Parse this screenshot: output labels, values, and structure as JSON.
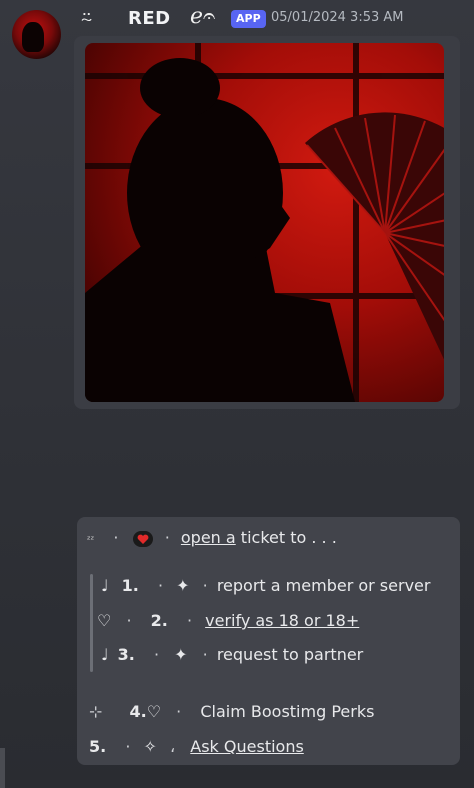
{
  "header": {
    "deco_left": "⍨",
    "bot_name": "RED",
    "deco_right": "ℯ𝄐",
    "badge": "APP",
    "timestamp": "05/01/2024 3:53 AM"
  },
  "embed_menu": {
    "title_prefix": "ᶻᶻ",
    "title_dot1": "·",
    "title_dot2": "·",
    "title_link": "open a",
    "title_rest": " ticket to . . .",
    "items": [
      {
        "marker": "♩",
        "num": "1.",
        "dots": "·",
        "star": "✦",
        "dot2": "·",
        "text": "report a member or server"
      },
      {
        "marker": "♡",
        "num": "2.",
        "dots": "·",
        "dot2": "·",
        "text": "verify as 18 or 18+"
      },
      {
        "marker": "♩",
        "num": "3.",
        "dots": "·",
        "star": "✦",
        "dot2": "·",
        "text": "request to partner"
      },
      {
        "marker": "⊹",
        "num": "4.",
        "heart": "♡",
        "dot2": "·",
        "text": "Claim Boostimg Perks"
      },
      {
        "num": "5.",
        "dots": "·",
        "star": "✧",
        "dot2": "،",
        "text": "Ask Questions"
      }
    ]
  },
  "colors": {
    "accent": "#5865f2",
    "background": "#313338",
    "embed": "#42444b"
  }
}
